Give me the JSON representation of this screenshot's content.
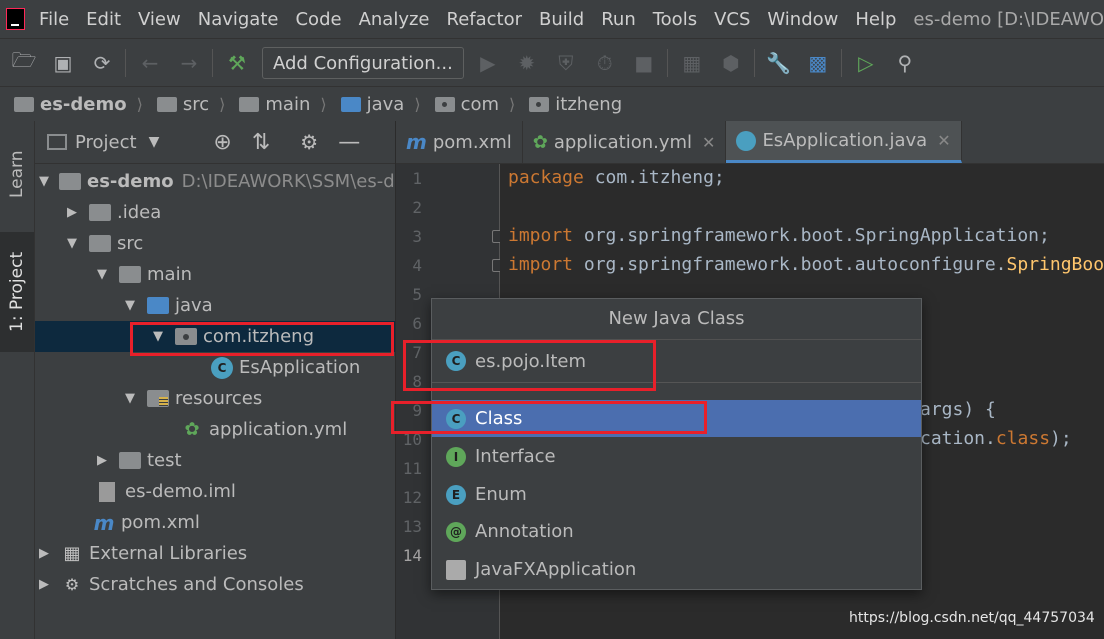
{
  "menubar": {
    "items": [
      "File",
      "Edit",
      "View",
      "Navigate",
      "Code",
      "Analyze",
      "Refactor",
      "Build",
      "Run",
      "Tools",
      "VCS",
      "Window",
      "Help"
    ],
    "window_title": "es-demo [D:\\IDEAWO"
  },
  "toolbar": {
    "add_configuration": "Add Configuration..."
  },
  "breadcrumb": [
    "es-demo",
    "src",
    "main",
    "java",
    "com",
    "itzheng"
  ],
  "left_strip": {
    "learn": "Learn",
    "project": "1: Project"
  },
  "project_panel": {
    "title": "Project",
    "tree": {
      "root_name": "es-demo",
      "root_path": "D:\\IDEAWORK\\SSM\\es-der",
      "idea": ".idea",
      "src": "src",
      "main": "main",
      "java": "java",
      "package": "com.itzheng",
      "es_application": "EsApplication",
      "resources": "resources",
      "application_yml": "application.yml",
      "test": "test",
      "iml": "es-demo.iml",
      "pom": "pom.xml",
      "external_libraries": "External Libraries",
      "scratches": "Scratches and Consoles"
    }
  },
  "editor": {
    "tabs": [
      "pom.xml",
      "application.yml",
      "EsApplication.java"
    ],
    "line_numbers": [
      "1",
      "2",
      "3",
      "4",
      "5",
      "6",
      "7",
      "8",
      "9",
      "10",
      "11",
      "12",
      "13",
      "14"
    ],
    "code": {
      "l1_kw": "package",
      "l1_rest": " com.itzheng;",
      "l3_kw": "import",
      "l3_rest": " org.springframework.boot.SpringApplication;",
      "l4_kw": "import",
      "l4_rest": " org.springframework.boot.autoconfigure.",
      "l4_type": "SpringBoo",
      "l9_tail": "args) {",
      "l10_tail_a": "cation.",
      "l10_tail_kw": "class",
      "l10_tail_b": ");"
    }
  },
  "popup": {
    "title": "New Java Class",
    "input_value": "es.pojo.Item",
    "kinds": [
      "Class",
      "Interface",
      "Enum",
      "Annotation",
      "JavaFXApplication"
    ],
    "kind_letters": [
      "C",
      "I",
      "E",
      "@",
      ""
    ],
    "selected": "Class"
  },
  "watermark": "https://blog.csdn.net/qq_44757034",
  "colors": {
    "selection": "#4b6eaf",
    "annotation_red": "#e8202a",
    "keyword": "#cc7832"
  }
}
